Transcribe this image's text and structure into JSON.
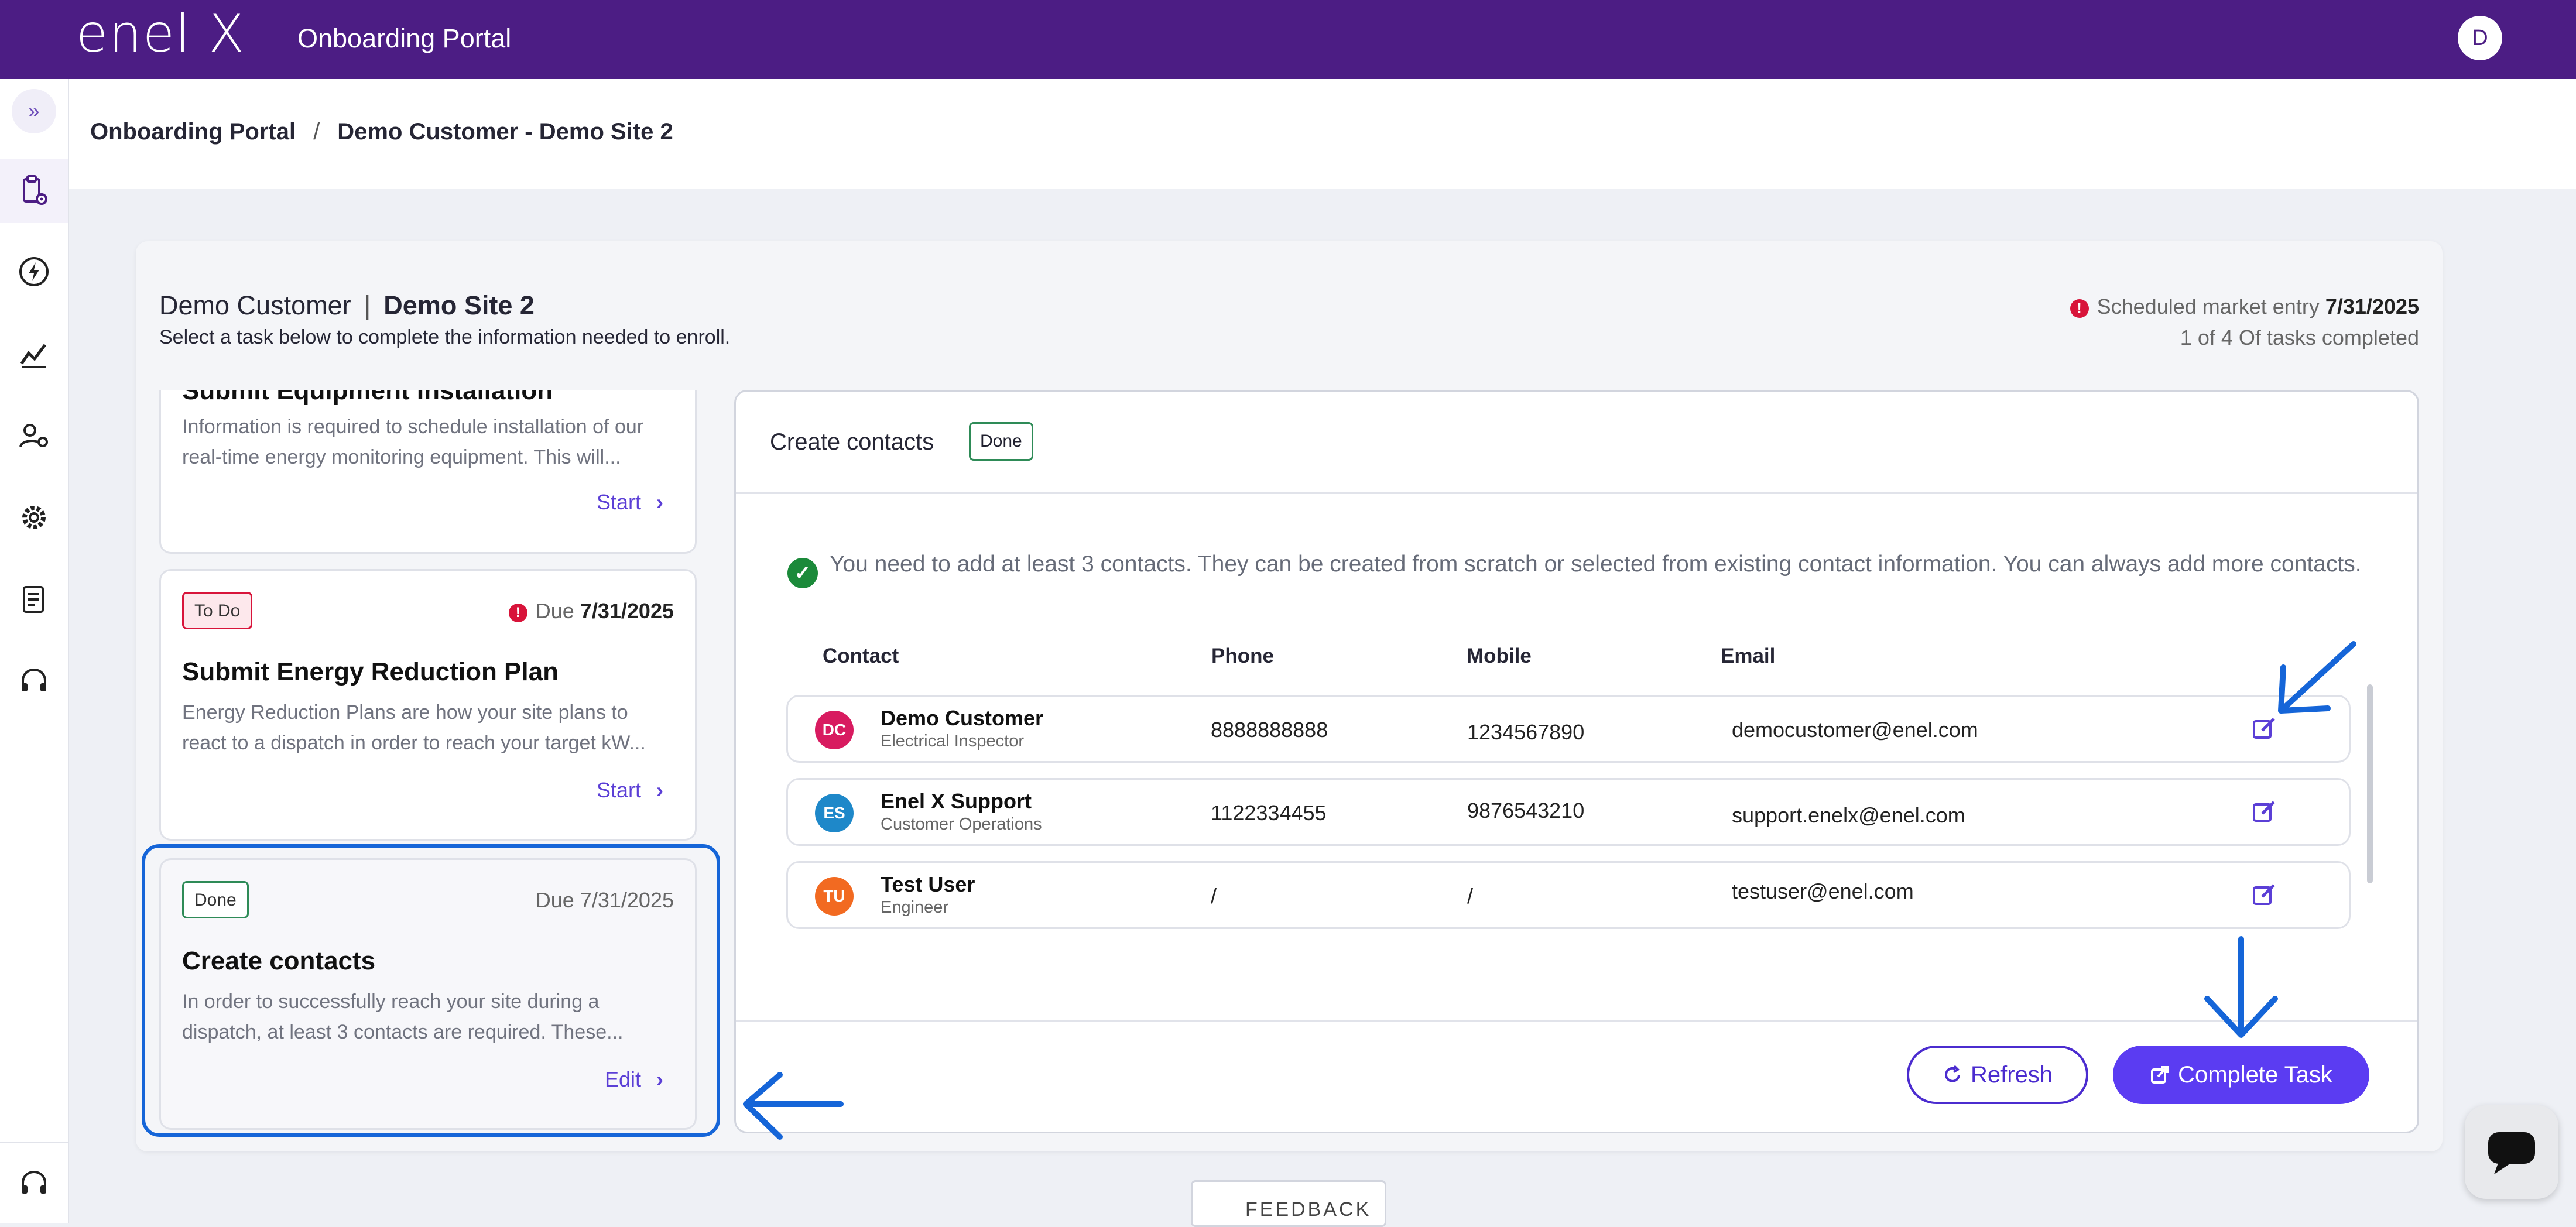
{
  "topbar": {
    "logo": "enel X",
    "app_title": "Onboarding Portal",
    "user_initial": "D"
  },
  "rail": {
    "expand_label": "»"
  },
  "breadcrumb": {
    "root": "Onboarding Portal",
    "separator": "/",
    "current": "Demo Customer - Demo Site 2"
  },
  "header": {
    "customer": "Demo Customer",
    "divider": "|",
    "site": "Demo Site 2",
    "subtitle": "Select a task below to complete the information needed to enroll.",
    "scheduled_label": "Scheduled market entry",
    "scheduled_date": "7/31/2025",
    "tasks_completed": "1 of 4 Of tasks completed"
  },
  "tasks": [
    {
      "title": "Submit Equipment Installation",
      "description": "Information is required to schedule installation of our real-time energy monitoring equipment. This will...",
      "action": "Start"
    },
    {
      "status": "To Do",
      "due_label": "Due",
      "due_date": "7/31/2025",
      "title": "Submit Energy Reduction Plan",
      "description": "Energy Reduction Plans are how your site plans to react to a dispatch in order to reach your target kW...",
      "action": "Start"
    },
    {
      "status": "Done",
      "due_label": "Due",
      "due_date": "7/31/2025",
      "title": "Create contacts",
      "description": "In order to successfully reach your site during a dispatch, at least 3 contacts are required. These...",
      "action": "Edit"
    }
  ],
  "panel": {
    "title": "Create contacts",
    "status": "Done",
    "info": "You need to add at least 3 contacts. They can be created from scratch or selected from existing contact information. You can always add more contacts.",
    "columns": [
      "Contact",
      "Phone",
      "Mobile",
      "Email"
    ],
    "contacts": [
      {
        "initials": "DC",
        "name": "Demo Customer",
        "role": "Electrical Inspector",
        "phone": "8888888888",
        "mobile": "1234567890",
        "email": "democustomer@enel.com",
        "color": "#d81b60"
      },
      {
        "initials": "ES",
        "name": "Enel X Support",
        "role": "Customer Operations",
        "phone": "1122334455",
        "mobile": "9876543210",
        "email": "support.enelx@enel.com",
        "color": "#1e88c9"
      },
      {
        "initials": "TU",
        "name": "Test User",
        "role": "Engineer",
        "phone": "/",
        "mobile": "/",
        "email": "testuser@enel.com",
        "color": "#f26a21"
      }
    ],
    "refresh_label": "Refresh",
    "complete_label": "Complete Task"
  },
  "footer": {
    "feedback_label": "FEEDBACK"
  },
  "colors": {
    "brand": "#4c1d84",
    "accent": "#5b3cf2",
    "done": "#2e8b57",
    "alert": "#d8143a",
    "annotation": "#1565d8"
  }
}
